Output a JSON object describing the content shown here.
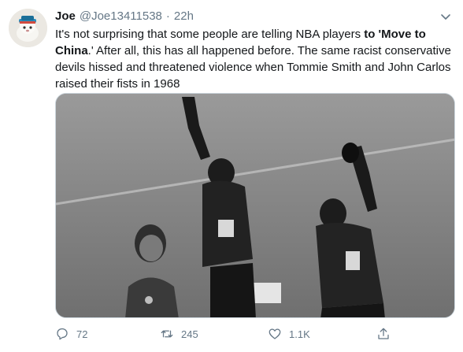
{
  "author": {
    "name": "Joe",
    "handle": "@Joe13411538",
    "separator": "·",
    "time": "22h"
  },
  "tweet": {
    "segments": [
      {
        "text": "It's not surprising that some people are telling NBA players ",
        "bold": false
      },
      {
        "text": "to 'Move to China",
        "bold": true
      },
      {
        "text": ".' After all, this has all happened before. The same racist conservative devils hissed and threatened violence when Tommie Smith and John Carlos raised their fists in 1968",
        "bold": false
      }
    ]
  },
  "media": {
    "description_icon": "photo"
  },
  "actions": {
    "reply_count": "72",
    "retweet_count": "245",
    "like_count": "1.1K"
  },
  "colors": {
    "text": "#14171a",
    "secondary": "#657786",
    "border": "#ccd6dd"
  }
}
